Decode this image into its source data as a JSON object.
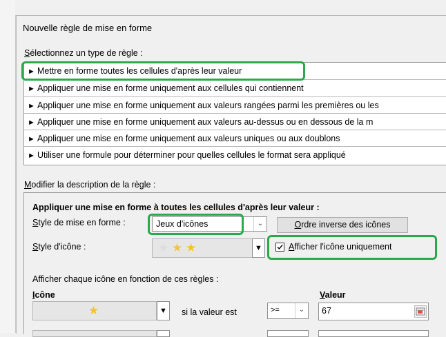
{
  "dialog": {
    "title": "Nouvelle règle de mise en forme"
  },
  "rule_type": {
    "section_label_u": "S",
    "section_label_rest": "électionnez un type de règle :",
    "items": [
      "Mettre en forme toutes les cellules d'après leur valeur",
      "Appliquer une mise en forme uniquement aux cellules qui contiennent",
      "Appliquer une mise en forme uniquement aux valeurs rangées parmi les premières ou les",
      "Appliquer une mise en forme uniquement aux valeurs au-dessus ou en dessous de la m",
      "Appliquer une mise en forme uniquement aux valeurs uniques ou aux doublons",
      "Utiliser une formule pour déterminer pour quelles cellules le format sera appliqué"
    ],
    "selected_index": 0
  },
  "description": {
    "section_label_u": "M",
    "section_label_rest": "odifier la description de la règle :",
    "heading": "Appliquer une mise en forme à toutes les cellules d'après leur valeur :",
    "format_style_label_u": "S",
    "format_style_label_rest": "tyle de mise en forme :",
    "format_style_value": "Jeux d'icônes",
    "reverse_button_u": "O",
    "reverse_button_rest": "rdre inverse des icônes",
    "icon_style_label_u": "S",
    "icon_style_label_rest": "tyle d'icône :",
    "show_icon_only_u": "A",
    "show_icon_only_rest": "fficher l'icône uniquement",
    "show_icon_only_checked": true,
    "rules_caption": "Afficher chaque icône en fonction de ces règles :",
    "col_icon_u": "I",
    "col_icon_rest": "cône",
    "col_value_u": "V",
    "col_value_rest": "aleur",
    "row1_condition": "si la valeur est",
    "row1_operator": ">=",
    "row1_value": "67"
  },
  "colors": {
    "highlight": "#2aa84a",
    "star_full": "#f5c518",
    "star_empty": "#e8e8e8"
  },
  "icons": {
    "rule_bullet": "black-right-pointer",
    "dropdown": "chevron-down-icon",
    "range_picker": "range-select-icon"
  }
}
